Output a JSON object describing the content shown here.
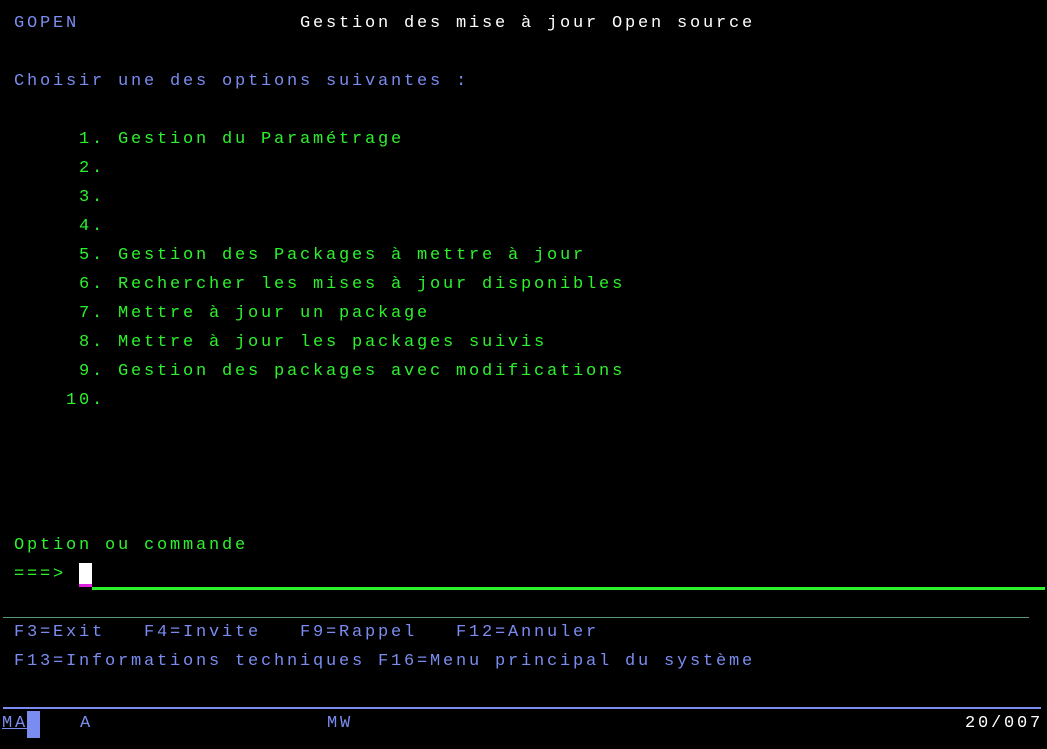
{
  "header": {
    "program": "GOPEN",
    "title": "Gestion des mise à jour Open source"
  },
  "prompt": "Choisir une des options suivantes :",
  "options": [
    {
      "num": "1.",
      "label": "Gestion du Paramétrage"
    },
    {
      "num": "2.",
      "label": ""
    },
    {
      "num": "3.",
      "label": ""
    },
    {
      "num": "4.",
      "label": ""
    },
    {
      "num": "5.",
      "label": "Gestion des Packages à mettre à jour"
    },
    {
      "num": "6.",
      "label": "Rechercher les mises à jour disponibles"
    },
    {
      "num": "7.",
      "label": "Mettre à jour un package"
    },
    {
      "num": "8.",
      "label": "Mettre à jour les packages suivis"
    },
    {
      "num": "9.",
      "label": "Gestion des packages avec modifications"
    },
    {
      "num": "10.",
      "label": ""
    }
  ],
  "command": {
    "label": "Option ou commande",
    "arrow": "===>",
    "value": ""
  },
  "function_keys": {
    "f3": "F3=Exit",
    "f4": "F4=Invite",
    "f9": "F9=Rappel",
    "f12": "F12=Annuler",
    "f13": "F13=Informations techniques",
    "f16": "F16=Menu principal du système"
  },
  "status_bar": {
    "session": "MA",
    "mode": "A",
    "system": "MW",
    "cursor_pos": "20/007"
  },
  "colors": {
    "green": "#2cf22c",
    "blue": "#7b8cf0",
    "background": "#000000"
  }
}
